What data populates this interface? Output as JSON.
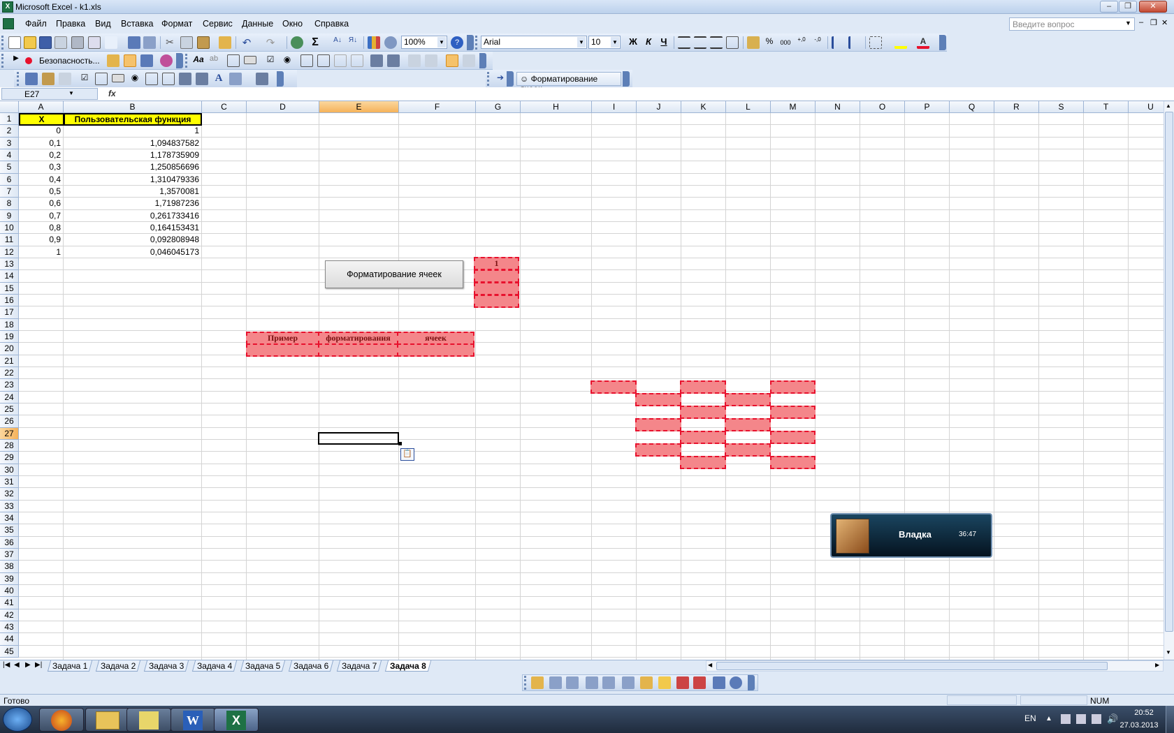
{
  "window": {
    "title": "Microsoft Excel - k1.xls",
    "app_icon": "excel-icon"
  },
  "menu": [
    "Файл",
    "Правка",
    "Вид",
    "Вставка",
    "Формат",
    "Сервис",
    "Данные",
    "Окно",
    "Справка"
  ],
  "help_placeholder": "Введите вопрос",
  "toolbar": {
    "zoom": "100%",
    "font": "Arial",
    "font_size": "10",
    "bold": "Ж",
    "italic": "К",
    "underline": "Ч",
    "security": "Безопасность...",
    "format_toolbar_title": "Форматирование ячеек",
    "percent": "%",
    "thousands": "000"
  },
  "namebox": "E27",
  "fx": "fx",
  "columns": [
    "A",
    "B",
    "C",
    "D",
    "E",
    "F",
    "G",
    "H",
    "I",
    "J",
    "K",
    "L",
    "M",
    "N",
    "O",
    "P",
    "Q",
    "R",
    "S",
    "T",
    "U"
  ],
  "rows": [
    "1",
    "2",
    "3",
    "4",
    "5",
    "6",
    "7",
    "8",
    "9",
    "10",
    "11",
    "12",
    "13",
    "14",
    "15",
    "16",
    "17",
    "18",
    "19",
    "20",
    "21",
    "22",
    "23",
    "24",
    "25",
    "26",
    "27",
    "28",
    "29",
    "30",
    "31",
    "32",
    "33",
    "34",
    "35",
    "36",
    "37",
    "38",
    "39",
    "40",
    "41",
    "42",
    "43",
    "44",
    "45"
  ],
  "table": {
    "header_x": "X",
    "header_f": "Пользовательская функция",
    "x": [
      "0",
      "0,1",
      "0,2",
      "0,3",
      "0,4",
      "0,5",
      "0,6",
      "0,7",
      "0,8",
      "0,9",
      "1"
    ],
    "f": [
      "1",
      "1,094837582",
      "1,178735909",
      "1,250856696",
      "1,310479336",
      "1,3570081",
      "1,71987236",
      "0,261733416",
      "0,164153431",
      "0,092808948",
      "0,046045173"
    ]
  },
  "button_label": "Форматирование ячеек",
  "merged_g13": "1",
  "row19": [
    "Пример",
    "форматирования",
    "ячеек"
  ],
  "sheets": [
    "Задача 1",
    "Задача 2",
    "Задача 3",
    "Задача 4",
    "Задача 5",
    "Задача 6",
    "Задача 7",
    "Задача 8"
  ],
  "active_sheet": "Задача 8",
  "status": {
    "ready": "Готово",
    "num": "NUM"
  },
  "popup": {
    "name": "Владка",
    "time": "36:47"
  },
  "tray": {
    "lang": "EN",
    "time": "20:52",
    "date": "27.03.2013"
  },
  "colors": {
    "pink_fill": "#f4868a",
    "pink_border": "#e8112d",
    "header_yellow": "#ffff00",
    "selected_header": "#f5b25a"
  }
}
